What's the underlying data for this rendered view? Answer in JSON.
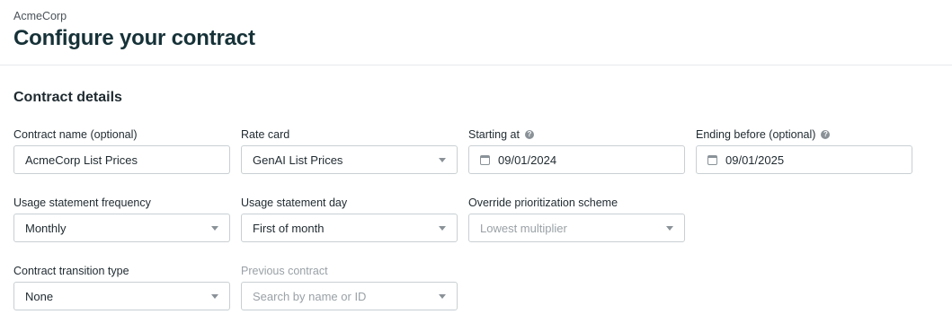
{
  "header": {
    "company": "AcmeCorp",
    "title": "Configure your contract"
  },
  "section": {
    "title": "Contract details"
  },
  "fields": {
    "contract_name": {
      "label": "Contract name (optional)",
      "value": "AcmeCorp List Prices"
    },
    "rate_card": {
      "label": "Rate card",
      "value": "GenAI List Prices"
    },
    "starting_at": {
      "label": "Starting at",
      "value": "09/01/2024",
      "help_icon": "question-circle-icon"
    },
    "ending_before": {
      "label": "Ending before (optional)",
      "value": "09/01/2025",
      "help_icon": "question-circle-icon"
    },
    "usage_statement_frequency": {
      "label": "Usage statement frequency",
      "value": "Monthly"
    },
    "usage_statement_day": {
      "label": "Usage statement day",
      "value": "First of month"
    },
    "override_prioritization": {
      "label": "Override prioritization scheme",
      "value": "Lowest multiplier"
    },
    "contract_transition_type": {
      "label": "Contract transition type",
      "value": "None"
    },
    "previous_contract": {
      "label": "Previous contract",
      "placeholder": "Search by name or ID"
    }
  },
  "help_glyph": "?",
  "colors": {
    "title": "#163238",
    "border": "#c9cfd3",
    "muted_text": "#9aa1a6",
    "icon": "#8a9298"
  }
}
